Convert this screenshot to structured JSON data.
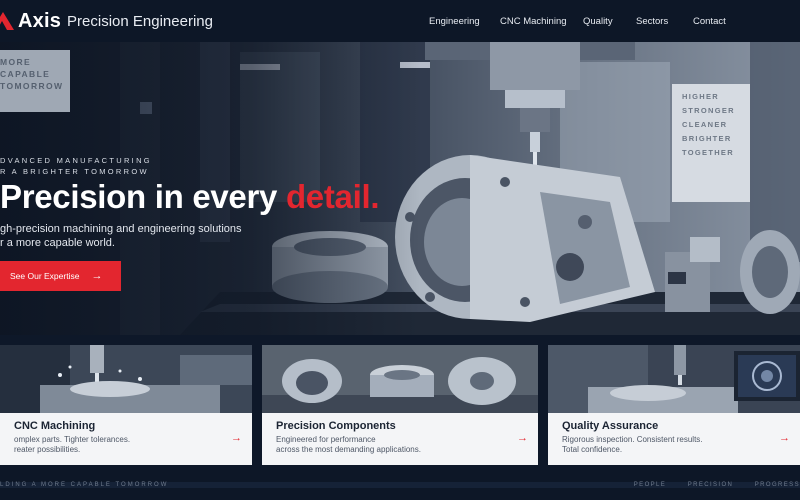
{
  "header": {
    "brand": "Axis",
    "brand_sub": "Precision Engineering",
    "nav": [
      "Engineering",
      "CNC Machining",
      "Quality",
      "Sectors",
      "Contact"
    ]
  },
  "hero": {
    "sign_left": [
      "MORE",
      "CAPABLE",
      "TOMORROW"
    ],
    "sign_right": [
      "HIGHER",
      "STRONGER",
      "CLEANER",
      "BRIGHTER",
      "TOGETHER"
    ],
    "eyebrow_1": "DVANCED MANUFACTURING",
    "eyebrow_2": "R A BRIGHTER TOMORROW",
    "title_main": "Precision in every ",
    "title_accent": "detail.",
    "sub_1": "gh-precision machining and engineering solutions",
    "sub_2": "r a more capable world.",
    "cta_label": "See Our Expertise",
    "cta_icon": "arrow-right-icon"
  },
  "cards": [
    {
      "title": "CNC Machining",
      "desc_1": "omplex parts. Tighter tolerances.",
      "desc_2": "reater possibilities.",
      "icon": "arrow-right-icon"
    },
    {
      "title": "Precision Components",
      "desc_1": "Engineered for performance",
      "desc_2": "across the most demanding applications.",
      "icon": "arrow-right-icon"
    },
    {
      "title": "Quality Assurance",
      "desc_1": "Rigorous inspection. Consistent results.",
      "desc_2": "Total confidence.",
      "icon": "arrow-right-icon"
    }
  ],
  "footer": {
    "left": "LDING A MORE CAPABLE TOMORROW",
    "right_1": "PEOPLE",
    "right_2": "PRECISION",
    "right_3": "PROGRESS"
  },
  "colors": {
    "accent": "#e3262f",
    "dark": "#0d1727",
    "card_bg": "#f4f5f7"
  }
}
